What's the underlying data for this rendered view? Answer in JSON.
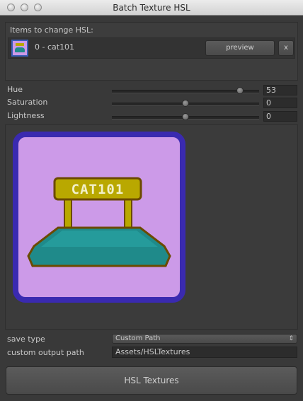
{
  "window": {
    "title": "Batch Texture HSL"
  },
  "items": {
    "heading": "Items to change HSL:",
    "list": [
      {
        "label": "0 - cat101",
        "preview_label": "preview",
        "remove_label": "x"
      }
    ]
  },
  "hsl": {
    "hue": {
      "label": "Hue",
      "value": "53",
      "fraction": 0.89
    },
    "saturation": {
      "label": "Saturation",
      "value": "0",
      "fraction": 0.5
    },
    "lightness": {
      "label": "Lightness",
      "value": "0",
      "fraction": 0.5
    }
  },
  "preview_image": {
    "text": "CAT101",
    "colors": {
      "background": "#cc9ae8",
      "border": "#3a2ab0",
      "sign": "#b9a800",
      "base": "#1f8a8a",
      "outline": "#6b4a00"
    }
  },
  "output": {
    "save_type_label": "save type",
    "save_type_value": "Custom Path",
    "path_label": "custom output path",
    "path_value": "Assets/HSLTextures"
  },
  "actions": {
    "apply_label": "HSL Textures"
  }
}
